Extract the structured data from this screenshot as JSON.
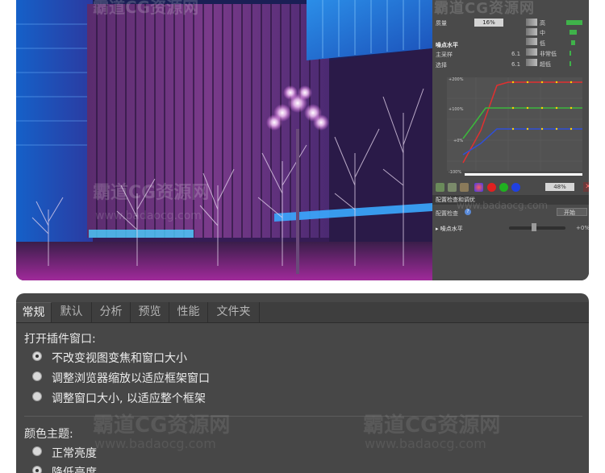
{
  "watermark": {
    "main": "霸道CG资源网",
    "url": "www.badaocg.com"
  },
  "side_panel": {
    "quality_label": "质量",
    "quality_value": "16%",
    "quality_levels": [
      {
        "label": "高",
        "bar": 1.0
      },
      {
        "label": "中",
        "bar": 0.45
      },
      {
        "label": "低",
        "bar": 0.25
      },
      {
        "label": "非常低",
        "bar": 0.1
      },
      {
        "label": "超低",
        "bar": 0.06
      }
    ],
    "noise_level_label": "噪点水平",
    "main_sampling_label": "主采样",
    "main_sampling_value": "6.1",
    "select_label": "选择",
    "select_value": "6.1",
    "curve_axis": {
      "top": "+200%",
      "mid": "+100%",
      "low": "+0%",
      "bottom": "-100%"
    },
    "zoom_value": "48%",
    "section_title": "配置检查和调优",
    "config_label": "配置检查",
    "start_button": "开始",
    "noise_slider_label": "噪点水平",
    "noise_slider_value": "+0%"
  },
  "dialog": {
    "tabs": [
      "常规",
      "默认",
      "分析",
      "预览",
      "性能",
      "文件夹"
    ],
    "active_tab": 0,
    "open_plugin_heading": "打开插件窗口:",
    "open_plugin_options": [
      {
        "label": "不改变视图变焦和窗口大小",
        "selected": true
      },
      {
        "label": "调整浏览器缩放以适应框架窗口",
        "selected": false
      },
      {
        "label": "调整窗口大小, 以适应整个框架",
        "selected": false
      }
    ],
    "color_theme_heading": "颜色主题:",
    "color_theme_options": [
      {
        "label": "正常亮度",
        "selected": false
      },
      {
        "label": "降低亮度",
        "selected": true
      }
    ]
  }
}
